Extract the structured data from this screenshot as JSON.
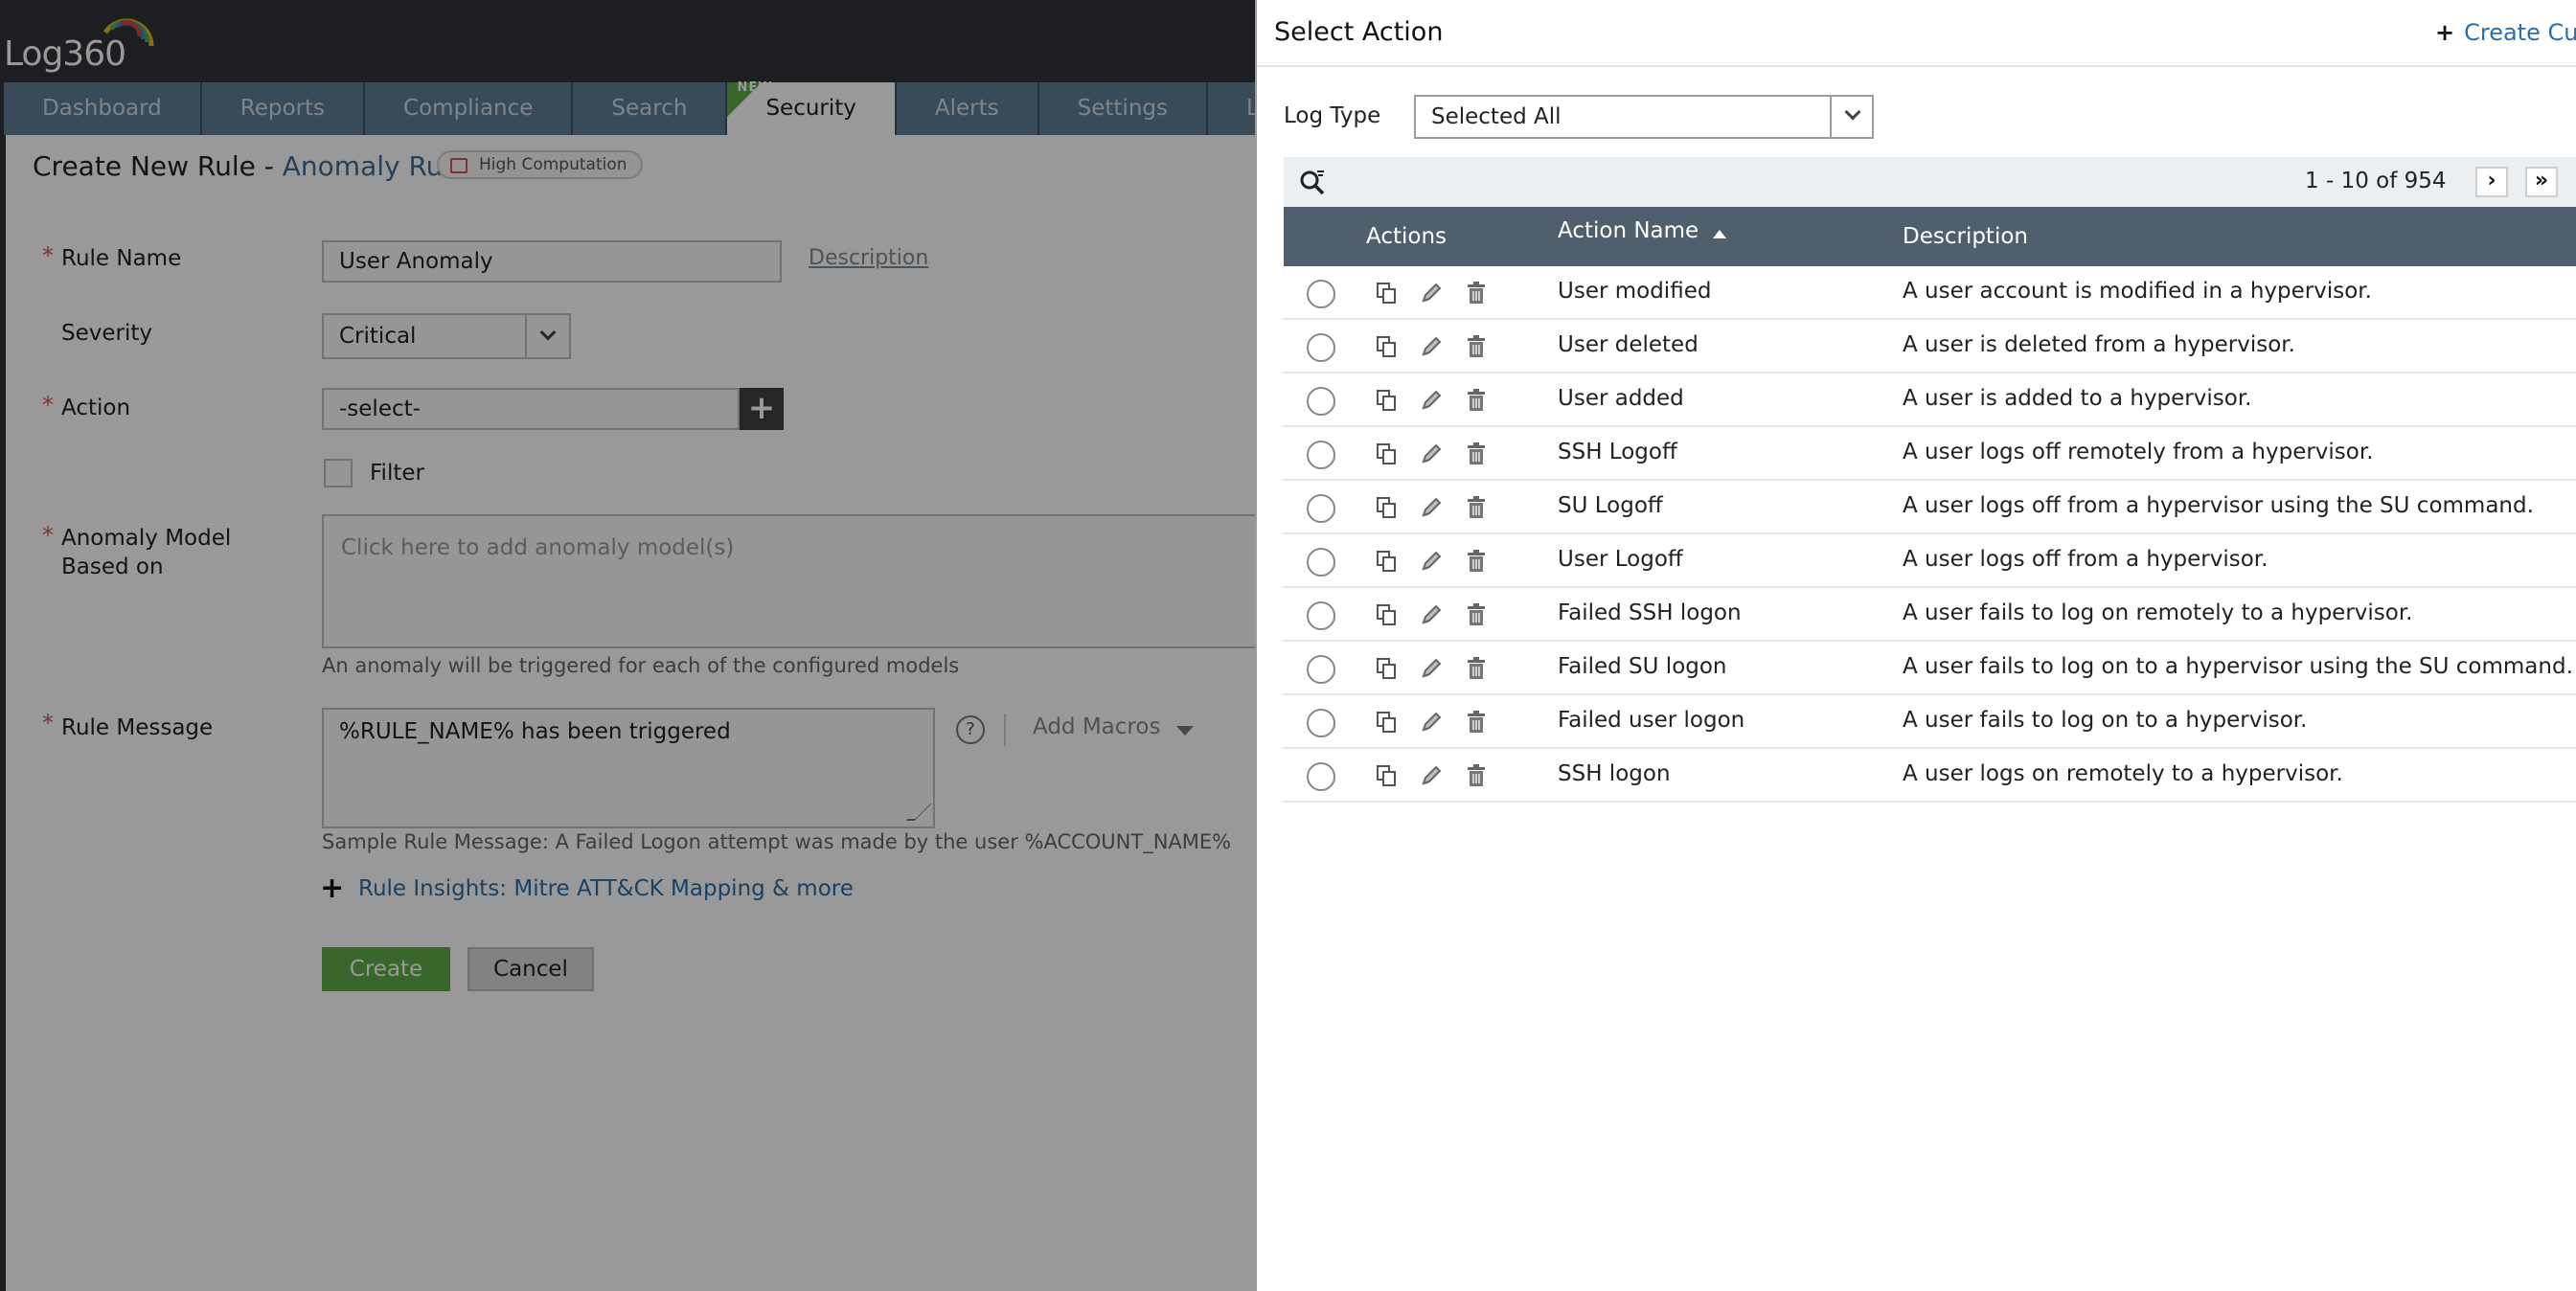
{
  "app": {
    "logo_text": "Log360",
    "nav_tabs": [
      {
        "label": "Dashboard"
      },
      {
        "label": "Reports"
      },
      {
        "label": "Compliance"
      },
      {
        "label": "Search"
      },
      {
        "label": "Security",
        "badge": "NEW",
        "active": true
      },
      {
        "label": "Alerts"
      },
      {
        "label": "Settings"
      },
      {
        "label": "Log"
      }
    ]
  },
  "form": {
    "heading": "Create New Rule - ",
    "heading_sub": "Anomaly Rule",
    "badge": "High Computation",
    "required_mark": "*",
    "rule_name_label": "Rule Name",
    "rule_name_value": "User Anomaly",
    "description_link": "Description",
    "severity_label": "Severity",
    "severity_value": "Critical",
    "action_label": "Action",
    "action_value": "-select-",
    "action_add": "+",
    "filter_label": "Filter",
    "anomaly_label_line1": "Anomaly Model",
    "anomaly_label_line2": "Based on",
    "anomaly_placeholder": "Click here to add anomaly model(s)",
    "anomaly_help": "An anomaly will be triggered for each of the configured models",
    "rule_message_label": "Rule Message",
    "rule_message_value": "%RULE_NAME% has been triggered",
    "help_glyph": "?",
    "add_macros": "Add Macros",
    "sample_message": "Sample Rule Message: A Failed Logon attempt was made by the user %ACCOUNT_NAME%",
    "insights_plus": "+",
    "insights_link": "Rule Insights: Mitre ATT&CK Mapping & more",
    "create_button": "Create",
    "cancel_button": "Cancel"
  },
  "panel": {
    "title": "Select Action",
    "create_custom_plus": "+",
    "create_custom": "Create Cus",
    "log_type_label": "Log Type",
    "log_type_value": "Selected All",
    "pager": "1 - 10 of 954",
    "next_glyph": "›",
    "last_glyph": "»",
    "columns": {
      "actions": "Actions",
      "name": "Action Name",
      "description": "Description"
    },
    "rows": [
      {
        "name": "User modified",
        "description": "A user account is modified in a hypervisor."
      },
      {
        "name": "User deleted",
        "description": "A user is deleted from a hypervisor."
      },
      {
        "name": "User added",
        "description": "A user is added to a hypervisor."
      },
      {
        "name": "SSH Logoff",
        "description": "A user logs off remotely from a hypervisor."
      },
      {
        "name": "SU Logoff",
        "description": "A user logs off from a hypervisor using the SU command."
      },
      {
        "name": "User Logoff",
        "description": "A user logs off from a hypervisor."
      },
      {
        "name": "Failed SSH logon",
        "description": "A user fails to log on remotely to a hypervisor."
      },
      {
        "name": "Failed SU logon",
        "description": "A user fails to log on to a hypervisor using the SU command."
      },
      {
        "name": "Failed user logon",
        "description": "A user fails to log on to a hypervisor."
      },
      {
        "name": "SSH logon",
        "description": "A user logs on remotely to a hypervisor."
      }
    ]
  },
  "icons": {
    "search": "search-filter-icon",
    "row_actions": [
      "copy-icon",
      "edit-icon",
      "delete-icon"
    ],
    "sort": "sort-ascending-icon"
  },
  "colors": {
    "topbar": "#2f3337",
    "nav_tab": "#5f7d95",
    "new_flag": "#5bab46",
    "create_button": "#5cac46",
    "grid_header": "#4f5f6e",
    "link": "#2a6fa8",
    "required": "#d9534f"
  }
}
